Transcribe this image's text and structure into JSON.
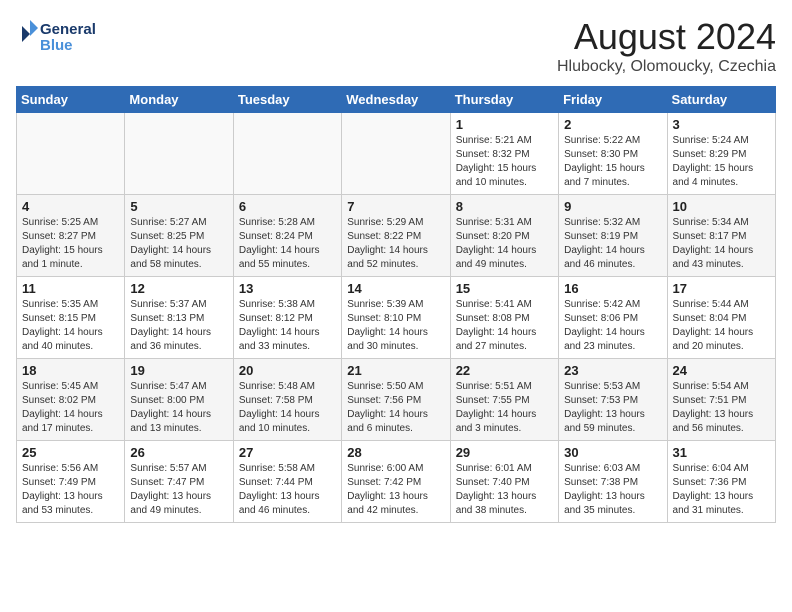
{
  "logo": {
    "line1": "General",
    "line2": "Blue"
  },
  "title": "August 2024",
  "location": "Hlubocky, Olomoucky, Czechia",
  "days_of_week": [
    "Sunday",
    "Monday",
    "Tuesday",
    "Wednesday",
    "Thursday",
    "Friday",
    "Saturday"
  ],
  "weeks": [
    [
      {
        "num": "",
        "info": ""
      },
      {
        "num": "",
        "info": ""
      },
      {
        "num": "",
        "info": ""
      },
      {
        "num": "",
        "info": ""
      },
      {
        "num": "1",
        "info": "Sunrise: 5:21 AM\nSunset: 8:32 PM\nDaylight: 15 hours\nand 10 minutes."
      },
      {
        "num": "2",
        "info": "Sunrise: 5:22 AM\nSunset: 8:30 PM\nDaylight: 15 hours\nand 7 minutes."
      },
      {
        "num": "3",
        "info": "Sunrise: 5:24 AM\nSunset: 8:29 PM\nDaylight: 15 hours\nand 4 minutes."
      }
    ],
    [
      {
        "num": "4",
        "info": "Sunrise: 5:25 AM\nSunset: 8:27 PM\nDaylight: 15 hours\nand 1 minute."
      },
      {
        "num": "5",
        "info": "Sunrise: 5:27 AM\nSunset: 8:25 PM\nDaylight: 14 hours\nand 58 minutes."
      },
      {
        "num": "6",
        "info": "Sunrise: 5:28 AM\nSunset: 8:24 PM\nDaylight: 14 hours\nand 55 minutes."
      },
      {
        "num": "7",
        "info": "Sunrise: 5:29 AM\nSunset: 8:22 PM\nDaylight: 14 hours\nand 52 minutes."
      },
      {
        "num": "8",
        "info": "Sunrise: 5:31 AM\nSunset: 8:20 PM\nDaylight: 14 hours\nand 49 minutes."
      },
      {
        "num": "9",
        "info": "Sunrise: 5:32 AM\nSunset: 8:19 PM\nDaylight: 14 hours\nand 46 minutes."
      },
      {
        "num": "10",
        "info": "Sunrise: 5:34 AM\nSunset: 8:17 PM\nDaylight: 14 hours\nand 43 minutes."
      }
    ],
    [
      {
        "num": "11",
        "info": "Sunrise: 5:35 AM\nSunset: 8:15 PM\nDaylight: 14 hours\nand 40 minutes."
      },
      {
        "num": "12",
        "info": "Sunrise: 5:37 AM\nSunset: 8:13 PM\nDaylight: 14 hours\nand 36 minutes."
      },
      {
        "num": "13",
        "info": "Sunrise: 5:38 AM\nSunset: 8:12 PM\nDaylight: 14 hours\nand 33 minutes."
      },
      {
        "num": "14",
        "info": "Sunrise: 5:39 AM\nSunset: 8:10 PM\nDaylight: 14 hours\nand 30 minutes."
      },
      {
        "num": "15",
        "info": "Sunrise: 5:41 AM\nSunset: 8:08 PM\nDaylight: 14 hours\nand 27 minutes."
      },
      {
        "num": "16",
        "info": "Sunrise: 5:42 AM\nSunset: 8:06 PM\nDaylight: 14 hours\nand 23 minutes."
      },
      {
        "num": "17",
        "info": "Sunrise: 5:44 AM\nSunset: 8:04 PM\nDaylight: 14 hours\nand 20 minutes."
      }
    ],
    [
      {
        "num": "18",
        "info": "Sunrise: 5:45 AM\nSunset: 8:02 PM\nDaylight: 14 hours\nand 17 minutes."
      },
      {
        "num": "19",
        "info": "Sunrise: 5:47 AM\nSunset: 8:00 PM\nDaylight: 14 hours\nand 13 minutes."
      },
      {
        "num": "20",
        "info": "Sunrise: 5:48 AM\nSunset: 7:58 PM\nDaylight: 14 hours\nand 10 minutes."
      },
      {
        "num": "21",
        "info": "Sunrise: 5:50 AM\nSunset: 7:56 PM\nDaylight: 14 hours\nand 6 minutes."
      },
      {
        "num": "22",
        "info": "Sunrise: 5:51 AM\nSunset: 7:55 PM\nDaylight: 14 hours\nand 3 minutes."
      },
      {
        "num": "23",
        "info": "Sunrise: 5:53 AM\nSunset: 7:53 PM\nDaylight: 13 hours\nand 59 minutes."
      },
      {
        "num": "24",
        "info": "Sunrise: 5:54 AM\nSunset: 7:51 PM\nDaylight: 13 hours\nand 56 minutes."
      }
    ],
    [
      {
        "num": "25",
        "info": "Sunrise: 5:56 AM\nSunset: 7:49 PM\nDaylight: 13 hours\nand 53 minutes."
      },
      {
        "num": "26",
        "info": "Sunrise: 5:57 AM\nSunset: 7:47 PM\nDaylight: 13 hours\nand 49 minutes."
      },
      {
        "num": "27",
        "info": "Sunrise: 5:58 AM\nSunset: 7:44 PM\nDaylight: 13 hours\nand 46 minutes."
      },
      {
        "num": "28",
        "info": "Sunrise: 6:00 AM\nSunset: 7:42 PM\nDaylight: 13 hours\nand 42 minutes."
      },
      {
        "num": "29",
        "info": "Sunrise: 6:01 AM\nSunset: 7:40 PM\nDaylight: 13 hours\nand 38 minutes."
      },
      {
        "num": "30",
        "info": "Sunrise: 6:03 AM\nSunset: 7:38 PM\nDaylight: 13 hours\nand 35 minutes."
      },
      {
        "num": "31",
        "info": "Sunrise: 6:04 AM\nSunset: 7:36 PM\nDaylight: 13 hours\nand 31 minutes."
      }
    ]
  ]
}
